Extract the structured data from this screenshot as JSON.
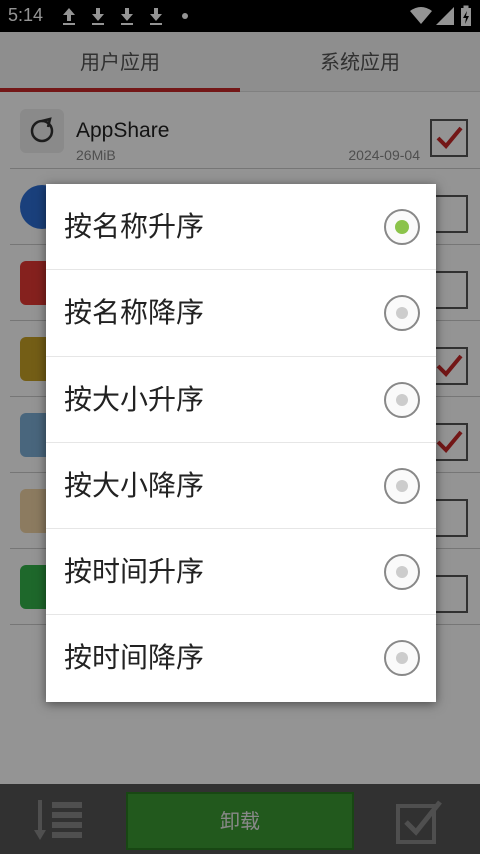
{
  "status_bar": {
    "time": "5:14"
  },
  "tabs": [
    {
      "label": "用户应用",
      "selected": true
    },
    {
      "label": "系统应用",
      "selected": false
    }
  ],
  "apps": [
    {
      "name": "AppShare",
      "size": "26MiB",
      "date": "2024-09-04",
      "checked": true,
      "icon": "appshare-icon"
    },
    {
      "name": "",
      "size": "",
      "date": "",
      "checked": false,
      "icon": "blue-play-icon",
      "icon_color": "#2d6fd6"
    },
    {
      "name": "",
      "size": "",
      "date": "",
      "checked": false,
      "icon": "huawei-icon",
      "icon_color": "#e53935"
    },
    {
      "name": "",
      "size": "",
      "date": "",
      "checked": true,
      "icon": "game-icon",
      "icon_color": "#c9a227"
    },
    {
      "name": "",
      "size": "",
      "date": "",
      "checked": true,
      "icon": "recycle-bin-icon",
      "icon_color": "#7fb0d8"
    },
    {
      "name": "",
      "size": "",
      "date": "",
      "checked": false,
      "icon": "chat-bubble-icon",
      "icon_color": "#f1d5a5"
    },
    {
      "name": "",
      "size": "",
      "date": "",
      "checked": false,
      "icon": "phone-icon",
      "icon_color": "#34b44a"
    }
  ],
  "bottom_bar": {
    "uninstall_label": "卸载"
  },
  "sort_dialog": {
    "options": [
      {
        "label": "按名称升序",
        "selected": true
      },
      {
        "label": "按名称降序",
        "selected": false
      },
      {
        "label": "按大小升序",
        "selected": false
      },
      {
        "label": "按大小降序",
        "selected": false
      },
      {
        "label": "按时间升序",
        "selected": false
      },
      {
        "label": "按时间降序",
        "selected": false
      }
    ]
  },
  "colors": {
    "accent": "#c62828",
    "selected_radio": "#8bc34a",
    "uninstall_button": "#3c9a32"
  }
}
